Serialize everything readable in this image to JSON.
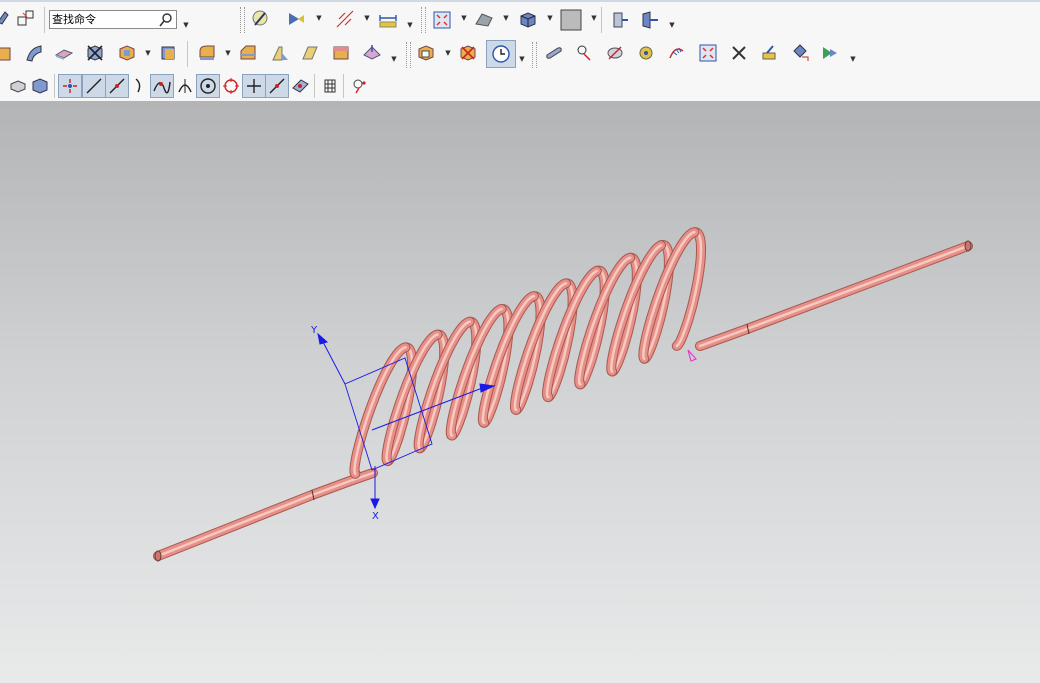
{
  "search": {
    "placeholder": "查找命令"
  },
  "toolbar": {
    "row1": [
      "sketch-icon",
      "datum-csys-icon",
      "command-finder-icon",
      "selection-filter-icon",
      "show-hide-icon",
      "measure-distance-icon",
      "fit-view-icon",
      "render-style-icon",
      "shaded-view-icon",
      "background-icon",
      "clip-section-icon",
      "edit-section-icon"
    ],
    "row2": [
      "extrude-icon",
      "sweep-icon",
      "datum-plane-icon",
      "trim-body-icon",
      "shell-icon",
      "pattern-icon",
      "edge-blend-icon",
      "chamfer-icon",
      "draft-icon",
      "mirror-icon",
      "offset-face-icon",
      "synchronous-icon",
      "replace-face-icon",
      "move-face-icon",
      "history-clock-icon",
      "tube-icon",
      "point-icon",
      "project-curve-icon",
      "analysis-icon",
      "curvature-icon",
      "fit-window-icon",
      "delete-icon",
      "measure-icon",
      "move-object-icon",
      "play-icon"
    ],
    "row3": [
      "solid-body-filter-icon",
      "feature-filter-icon",
      "snap-end-point-icon",
      "snap-mid-point-icon",
      "snap-control-point-icon",
      "snap-curve-icon",
      "snap-intersection-icon",
      "snap-tangent-icon",
      "snap-arc-center-icon",
      "snap-quadrant-icon",
      "snap-existing-point-icon",
      "snap-on-curve-icon",
      "snap-on-face-icon",
      "grid-icon",
      "point-constructor-icon"
    ],
    "active_snaps": [
      "snap-end-point-icon",
      "snap-mid-point-icon",
      "snap-control-point-icon",
      "snap-intersection-icon",
      "snap-arc-center-icon",
      "snap-existing-point-icon",
      "snap-on-curve-icon"
    ]
  },
  "viewport": {
    "model": "helical-coil-spring",
    "turns": 10,
    "spring_color": "#e69088",
    "csys_color": "#1a1ae6",
    "axes": {
      "y_label": "Y",
      "x_label": "X"
    }
  }
}
